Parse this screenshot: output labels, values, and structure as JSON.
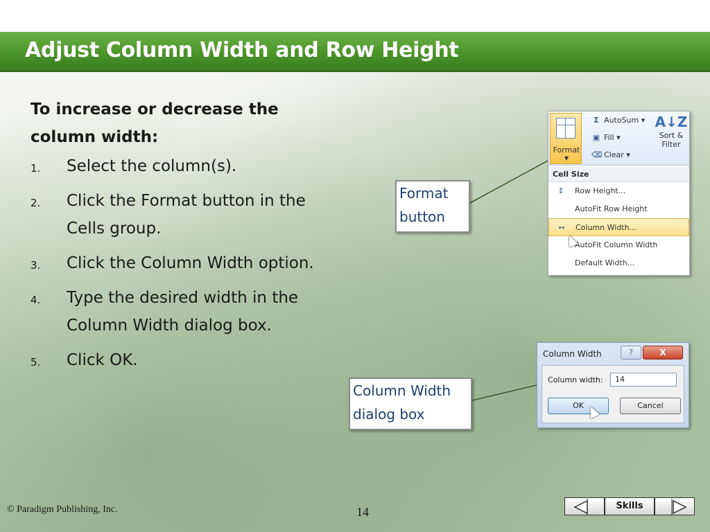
{
  "slide": {
    "title": "Adjust Column Width and Row Height",
    "intro": "To increase or decrease the column width:",
    "steps": [
      {
        "num": "1.",
        "text": "Select the column(s)."
      },
      {
        "num": "2.",
        "text": "Click the Format button in the Cells group."
      },
      {
        "num": "3.",
        "text": "Click the Column Width option."
      },
      {
        "num": "4.",
        "text": "Type the desired width in the Column Width dialog box."
      },
      {
        "num": "5.",
        "text": "Click OK."
      }
    ]
  },
  "callouts": {
    "format": {
      "line1": "Format",
      "line2": "button"
    },
    "dialog": {
      "line1": "Column Width",
      "line2": "dialog box"
    }
  },
  "ribbon": {
    "format_label": "Format",
    "autosum": "AutoSum",
    "fill": "Fill",
    "clear": "Clear",
    "sort_line1": "Sort &",
    "sort_line2": "Filter",
    "menu_header": "Cell Size",
    "menu_items": [
      "Row Height...",
      "AutoFit Row Height",
      "Column Width...",
      "AutoFit Column Width",
      "Default Width..."
    ]
  },
  "dialog": {
    "title": "Column Width",
    "help": "?",
    "close": "X",
    "label": "Column width:",
    "value": "14",
    "ok": "OK",
    "cancel": "Cancel"
  },
  "footer": {
    "copyright": "© Paradigm Publishing, Inc.",
    "page": "14",
    "skills": "Skills"
  },
  "colors": {
    "title_bar": "#4a9428",
    "title_text": "#ffffff",
    "callout_text": "#1e3f6e"
  }
}
